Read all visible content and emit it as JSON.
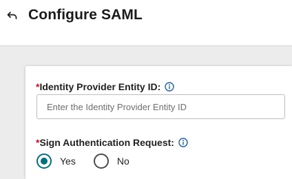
{
  "header": {
    "title": "Configure SAML",
    "back_icon": "back-arrow-icon"
  },
  "form": {
    "entity_id": {
      "required_mark": "*",
      "label": "Identity Provider Entity ID:",
      "info_icon": "info-icon",
      "placeholder": "Enter the Identity Provider Entity ID",
      "value": ""
    },
    "sign_request": {
      "required_mark": "*",
      "label": "Sign Authentication Request:",
      "info_icon": "info-icon",
      "options": [
        {
          "label": "Yes",
          "selected": true
        },
        {
          "label": "No",
          "selected": false
        }
      ]
    }
  },
  "colors": {
    "accent": "#00717c",
    "required": "#c8102e",
    "info": "#1a5fb4"
  }
}
